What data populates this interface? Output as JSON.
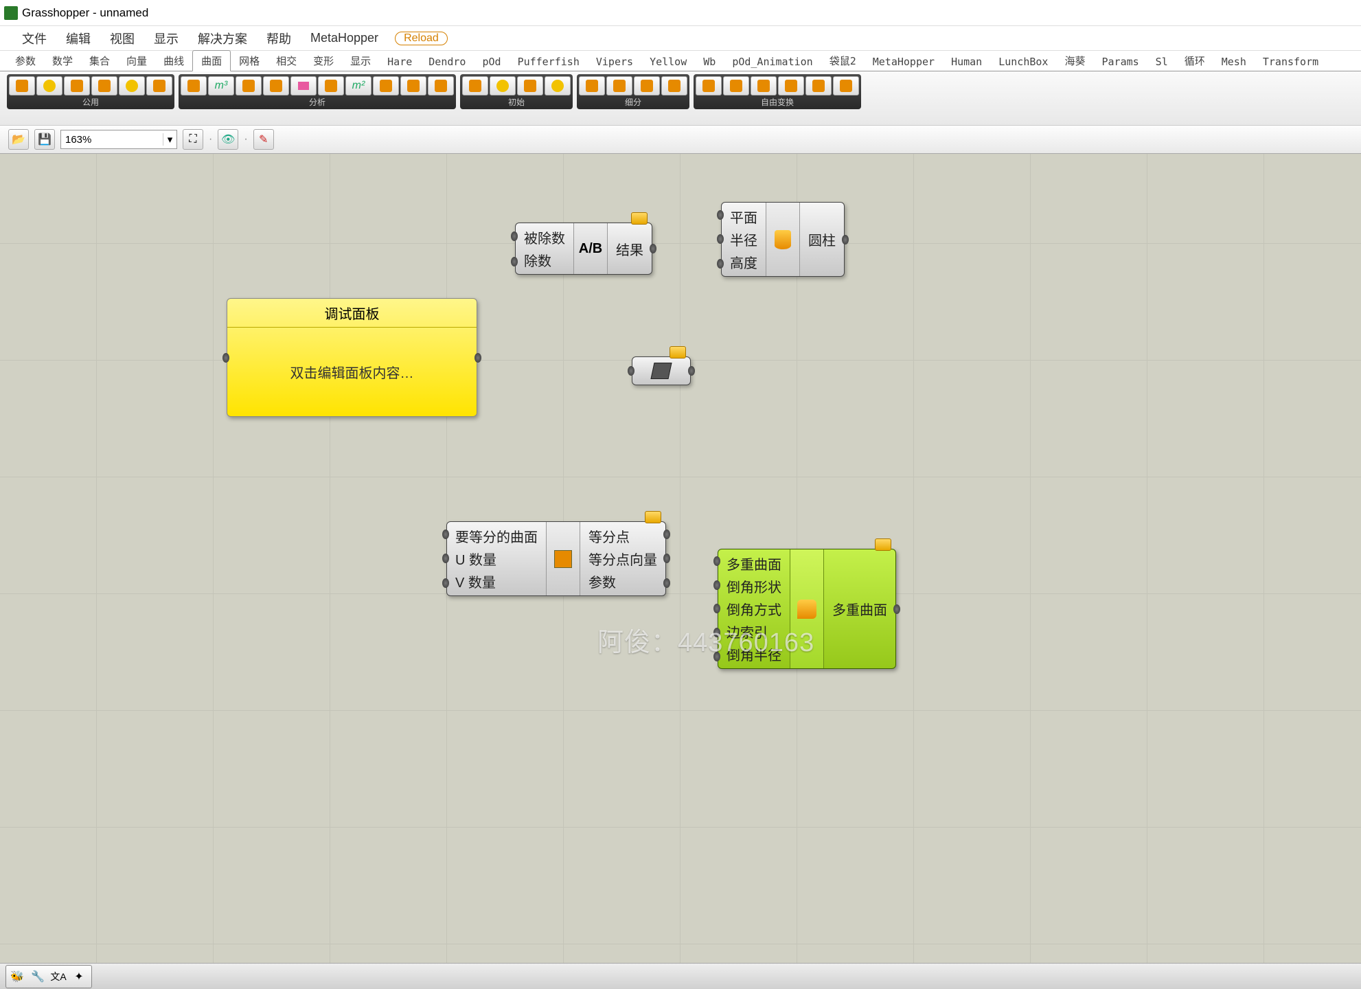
{
  "titlebar": {
    "app": "Grasshopper",
    "doc": "unnamed"
  },
  "menu": {
    "items": [
      "文件",
      "编辑",
      "视图",
      "显示",
      "解决方案",
      "帮助",
      "MetaHopper"
    ],
    "reload": "Reload"
  },
  "tabs": {
    "items": [
      "参数",
      "数学",
      "集合",
      "向量",
      "曲线",
      "曲面",
      "网格",
      "相交",
      "变形",
      "显示",
      "Hare",
      "Dendro",
      "pOd",
      "Pufferfish",
      "Vipers",
      "Yellow",
      "Wb",
      "pOd_Animation",
      "袋鼠2",
      "MetaHopper",
      "Human",
      "LunchBox",
      "海葵",
      "Params",
      "Sl",
      "循环",
      "Mesh",
      "Transform"
    ],
    "active": "曲面"
  },
  "ribbon": {
    "groups": [
      {
        "label": "公用",
        "rows": 2,
        "cols": 3
      },
      {
        "label": "分析",
        "rows": 2,
        "cols": 5
      },
      {
        "label": "初始",
        "rows": 2,
        "cols": 2
      },
      {
        "label": "细分",
        "rows": 2,
        "cols": 2
      },
      {
        "label": "自由变换",
        "rows": 2,
        "cols": 3
      }
    ]
  },
  "toolbar": {
    "zoom": "163%"
  },
  "components": {
    "divide": {
      "inputs": [
        "被除数",
        "除数"
      ],
      "outputs": [
        "结果"
      ],
      "icon": "A/B"
    },
    "cylinder": {
      "inputs": [
        "平面",
        "半径",
        "高度"
      ],
      "outputs": [
        "圆柱"
      ]
    },
    "panel": {
      "title": "调试面板",
      "body": "双击编辑面板内容…"
    },
    "srfdivide": {
      "inputs": [
        "要等分的曲面",
        "U 数量",
        "V 数量"
      ],
      "outputs": [
        "等分点",
        "等分点向量",
        "参数"
      ]
    },
    "fillet": {
      "inputs": [
        "多重曲面",
        "倒角形状",
        "倒角方式",
        "边索引",
        "倒角半径"
      ],
      "outputs": [
        "多重曲面"
      ]
    }
  },
  "watermark": "阿俊：443760163"
}
